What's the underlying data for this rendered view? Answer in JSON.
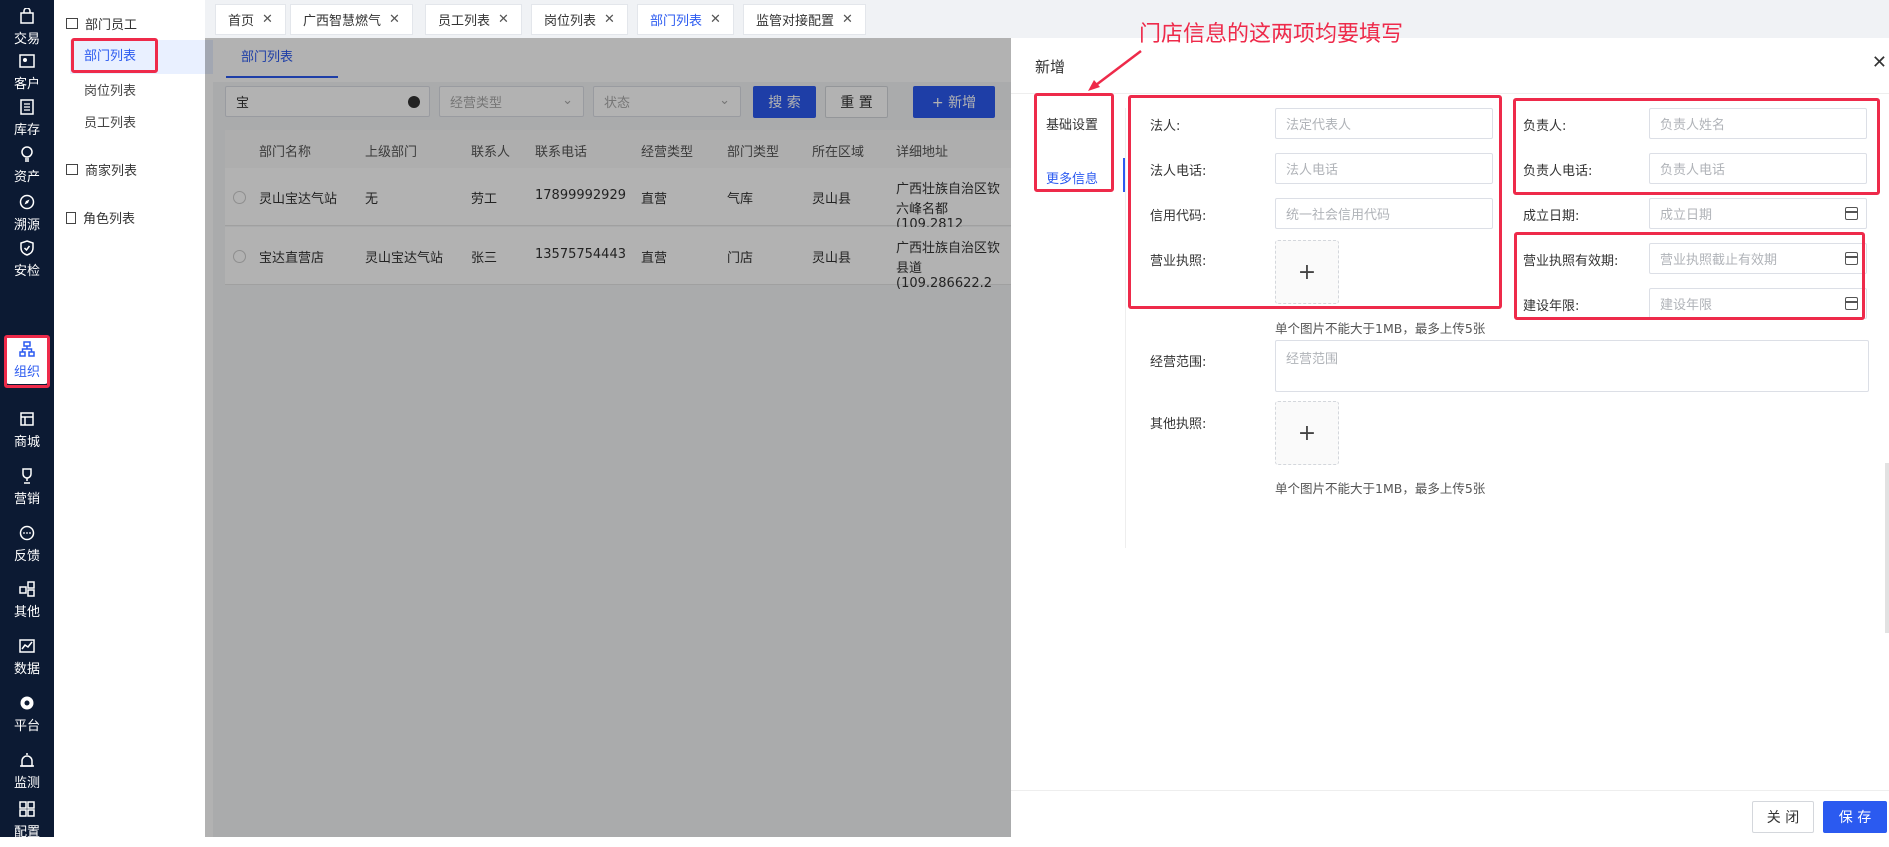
{
  "rail": {
    "items": [
      {
        "label": "交易",
        "icon": "bag-icon"
      },
      {
        "label": "客户",
        "icon": "contact-card-icon"
      },
      {
        "label": "库存",
        "icon": "list-doc-icon"
      },
      {
        "label": "资产",
        "icon": "lightbulb-icon"
      },
      {
        "label": "溯源",
        "icon": "compass-icon"
      },
      {
        "label": "安检",
        "icon": "shield-check-icon"
      },
      {
        "label": "组织",
        "icon": "org-chart-icon"
      },
      {
        "label": "商城",
        "icon": "store-icon"
      },
      {
        "label": "营销",
        "icon": "trophy-icon"
      },
      {
        "label": "反馈",
        "icon": "chat-bubble-icon"
      },
      {
        "label": "其他",
        "icon": "grid-dots-icon"
      },
      {
        "label": "数据",
        "icon": "line-chart-icon"
      },
      {
        "label": "平台",
        "icon": "platform-icon"
      },
      {
        "label": "监测",
        "icon": "alarm-icon"
      },
      {
        "label": "配置",
        "icon": "config-grid-icon"
      }
    ]
  },
  "submenu": {
    "group1": "部门员工",
    "items": [
      "部门列表",
      "岗位列表",
      "员工列表"
    ],
    "group2": "商家列表",
    "group3": "角色列表"
  },
  "tabs": [
    "首页",
    "广西智慧燃气",
    "员工列表",
    "岗位列表",
    "部门列表",
    "监管对接配置"
  ],
  "list": {
    "inner_tab": "部门列表",
    "search_value": "宝",
    "type_placeholder": "经营类型",
    "status_placeholder": "状态",
    "search_btn": "搜 索",
    "reset_btn": "重 置",
    "add_btn": "+ 新增",
    "columns": [
      "部门名称",
      "上级部门",
      "联系人",
      "联系电话",
      "经营类型",
      "部门类型",
      "所在区域",
      "详细地址"
    ],
    "rows": [
      {
        "name": "灵山宝达气站",
        "parent": "无",
        "contact": "劳工",
        "phone": "17899992929",
        "biz": "直营",
        "dept": "气库",
        "area": "灵山县",
        "addr1": "广西壮族自治区钦",
        "addr2": "六峰名都(109.2812"
      },
      {
        "name": "宝达直营店",
        "parent": "灵山宝达气站",
        "contact": "张三",
        "phone": "13575754443",
        "biz": "直营",
        "dept": "门店",
        "area": "灵山县",
        "addr1": "广西壮族自治区钦",
        "addr2": "县道(109.286622.2"
      }
    ]
  },
  "drawer": {
    "title": "新增",
    "side_tab1": "基础设置",
    "side_tab2": "更多信息",
    "legal_label": "法人:",
    "legal_ph": "法定代表人",
    "legal_phone_label": "法人电话:",
    "legal_phone_ph": "法人电话",
    "credit_label": "信用代码:",
    "credit_ph": "统一社会信用代码",
    "license_label": "营业执照:",
    "owner_label": "负责人:",
    "owner_ph": "负责人姓名",
    "owner_phone_label": "负责人电话:",
    "owner_phone_ph": "负责人电话",
    "found_label": "成立日期:",
    "found_ph": "成立日期",
    "license_valid_label": "营业执照有效期:",
    "license_valid_ph": "营业执照截止有效期",
    "build_label": "建设年限:",
    "build_ph": "建设年限",
    "upload_hint": "单个图片不能大于1MB，最多上传5张",
    "scope_label": "经营范围:",
    "scope_ph": "经营范围",
    "other_label": "其他执照:",
    "upload_hint2": "单个图片不能大于1MB，最多上传5张",
    "close_btn": "关 闭",
    "save_btn": "保 存"
  },
  "annotation": "门店信息的这两项均要填写",
  "colors": {
    "accent": "#2b5af0",
    "rail_bg": "#0c1a33",
    "highlight": "#ee2a4a"
  }
}
